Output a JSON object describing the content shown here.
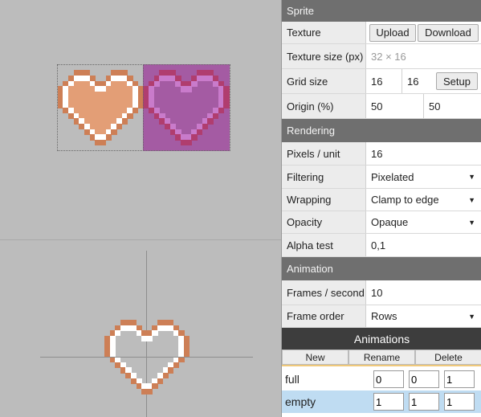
{
  "colors": {
    "outline": "#cd7f56",
    "highlight": "#ffffff",
    "fill": "#e39e76",
    "purple_bg": "#a45ba3",
    "purple_outline": "#b03d6f",
    "purple_highlight": "#c97bcb"
  },
  "sprite": {
    "header": "Sprite",
    "texture_label": "Texture",
    "upload": "Upload",
    "download": "Download",
    "texture_size_label": "Texture size (px)",
    "texture_size": "32 × 16",
    "grid_label": "Grid size",
    "grid_w": "16",
    "grid_h": "16",
    "setup": "Setup",
    "origin_label": "Origin (%)",
    "origin_x": "50",
    "origin_y": "50"
  },
  "rendering": {
    "header": "Rendering",
    "ppu_label": "Pixels / unit",
    "ppu": "16",
    "filtering_label": "Filtering",
    "filtering": "Pixelated",
    "wrapping_label": "Wrapping",
    "wrapping": "Clamp to edge",
    "opacity_label": "Opacity",
    "opacity": "Opaque",
    "alpha_label": "Alpha test",
    "alpha": "0,1"
  },
  "animation": {
    "header": "Animation",
    "fps_label": "Frames / second",
    "fps": "10",
    "order_label": "Frame order",
    "order": "Rows"
  },
  "animations": {
    "header": "Animations",
    "new": "New",
    "rename": "Rename",
    "delete": "Delete",
    "items": [
      {
        "name": "full",
        "a": "0",
        "b": "0",
        "c": "1"
      },
      {
        "name": "empty",
        "a": "1",
        "b": "1",
        "c": "1"
      }
    ]
  }
}
